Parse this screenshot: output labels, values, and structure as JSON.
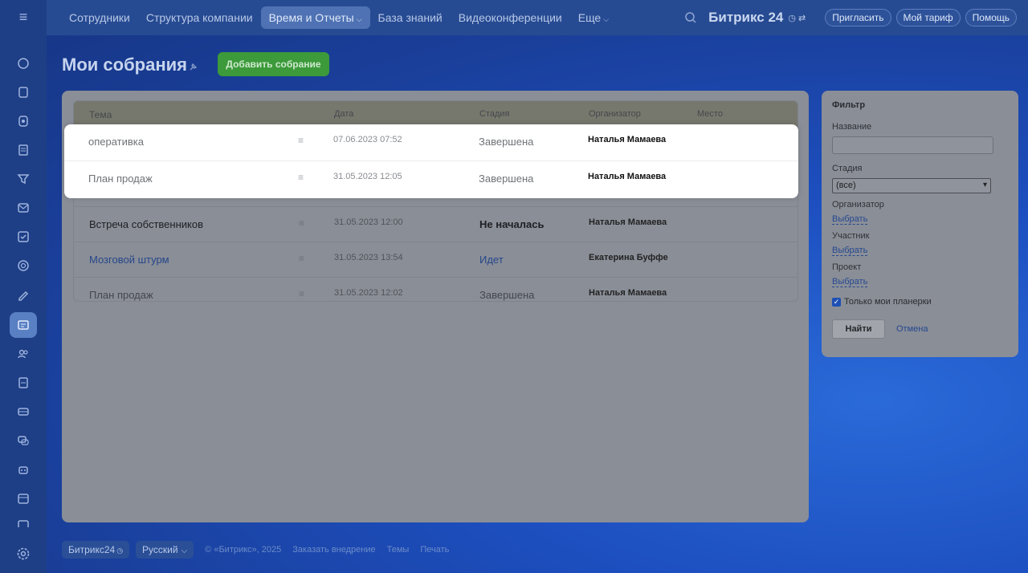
{
  "topnav": {
    "items": [
      {
        "label": "Сотрудники"
      },
      {
        "label": "Структура компании"
      },
      {
        "label": "Время и Отчеты"
      },
      {
        "label": "База знаний"
      },
      {
        "label": "Видеоконференции"
      },
      {
        "label": "Еще"
      }
    ],
    "active_index": 2,
    "brand": "Битрикс 24",
    "invite": "Пригласить",
    "tariff": "Мой тариф",
    "help": "Помощь"
  },
  "page": {
    "title": "Мои собрания",
    "add_button": "Добавить собрание"
  },
  "table": {
    "columns": {
      "topic": "Тема",
      "date": "Дата",
      "stage": "Стадия",
      "organizer": "Организатор",
      "place": "Место"
    },
    "rows": [
      {
        "topic": "оперативка",
        "date": "07.06.2023 07:52",
        "stage": "Завершена",
        "organizer": "Наталья Мамаева"
      },
      {
        "topic": "План продаж",
        "date": "31.05.2023 12:05",
        "stage": "Завершена",
        "organizer": "Наталья Мамаева"
      },
      {
        "topic": "Встреча собственников",
        "date": "31.05.2023 12:00",
        "stage": "Не началась",
        "organizer": "Наталья Мамаева"
      },
      {
        "topic": "Мозговой штурм",
        "date": "31.05.2023 13:54",
        "stage": "Идет",
        "organizer": "Екатерина Буффе"
      },
      {
        "topic": "План продаж",
        "date": "31.05.2023 12:02",
        "stage": "Завершена",
        "organizer": "Наталья Мамаева"
      }
    ]
  },
  "filter": {
    "title": "Фильтр",
    "name_label": "Название",
    "name_value": "",
    "stage_label": "Стадия",
    "stage_value": "(все)",
    "organizer_label": "Организатор",
    "organizer_link": "Выбрать",
    "participant_label": "Участник",
    "participant_link": "Выбрать",
    "project_label": "Проект",
    "project_link": "Выбрать",
    "only_mine_label": "Только мои планерки",
    "only_mine_checked": true,
    "find_button": "Найти",
    "cancel_link": "Отмена"
  },
  "footer": {
    "brand": "Битрикс24",
    "language": "Русский",
    "copyright": "© «Битрикс», 2025",
    "order": "Заказать внедрение",
    "themes": "Темы",
    "print": "Печать"
  },
  "colors": {
    "accent_green": "#3c9a3a",
    "link_blue": "#254890",
    "background_blue": "#1d4fc0"
  }
}
